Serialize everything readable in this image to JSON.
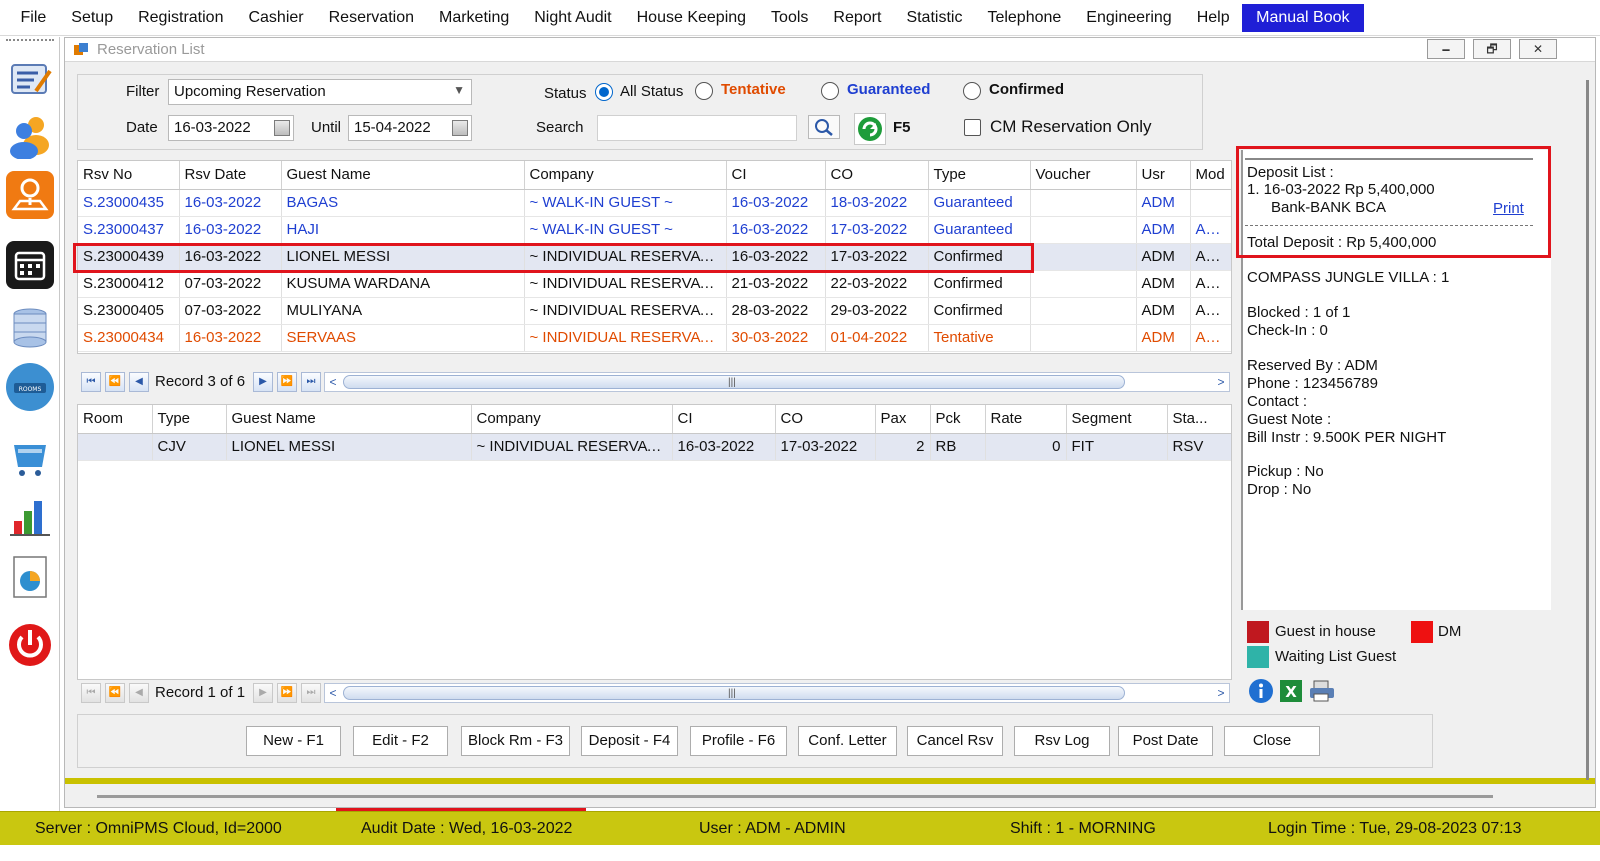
{
  "menu": [
    "File",
    "Setup",
    "Registration",
    "Cashier",
    "Reservation",
    "Marketing",
    "Night Audit",
    "House Keeping",
    "Tools",
    "Report",
    "Statistic",
    "Telephone",
    "Engineering",
    "Help",
    "Manual Book"
  ],
  "window": {
    "title": "Reservation List",
    "min": "🗕",
    "restore": "🗗",
    "close": "✕"
  },
  "filter": {
    "filter_label": "Filter",
    "filter_value": "Upcoming Reservation",
    "date_label": "Date",
    "date_from": "16-03-2022",
    "until_label": "Until",
    "date_until": "15-04-2022",
    "status_label": "Status",
    "status_all": "All Status",
    "status_tentative": "Tentative",
    "status_guaranteed": "Guaranteed",
    "status_confirmed": "Confirmed",
    "search_label": "Search",
    "search_value": "",
    "refresh_label": "F5",
    "cm_only": "CM Reservation Only",
    "tentative_color": "#e04b00",
    "guaranteed_color": "#1f3fd1",
    "confirmed_color": "#111111"
  },
  "reservations": {
    "headers": [
      "Rsv No",
      "Rsv Date",
      "Guest Name",
      "Company",
      "CI",
      "CO",
      "Type",
      "Voucher",
      "Usr",
      "Mod"
    ],
    "rows": [
      {
        "rsv_no": "S.23000435",
        "rsv_date": "16-03-2022",
        "guest": "BAGAS",
        "company": "~ WALK-IN GUEST ~",
        "ci": "16-03-2022",
        "co": "18-03-2022",
        "type": "Guaranteed",
        "voucher": "",
        "usr": "ADM",
        "mod": ""
      },
      {
        "rsv_no": "S.23000437",
        "rsv_date": "16-03-2022",
        "guest": "HAJI",
        "company": "~ WALK-IN GUEST ~",
        "ci": "16-03-2022",
        "co": "17-03-2022",
        "type": "Guaranteed",
        "voucher": "",
        "usr": "ADM",
        "mod": "ADM"
      },
      {
        "rsv_no": "S.23000439",
        "rsv_date": "16-03-2022",
        "guest": "LIONEL MESSI",
        "company": "~ INDIVIDUAL RESERVATI...",
        "ci": "16-03-2022",
        "co": "17-03-2022",
        "type": "Confirmed",
        "voucher": "",
        "usr": "ADM",
        "mod": "ADM"
      },
      {
        "rsv_no": "S.23000412",
        "rsv_date": "07-03-2022",
        "guest": "KUSUMA WARDANA",
        "company": "~ INDIVIDUAL RESERVATI...",
        "ci": "21-03-2022",
        "co": "22-03-2022",
        "type": "Confirmed",
        "voucher": "",
        "usr": "ADM",
        "mod": "ADM"
      },
      {
        "rsv_no": "S.23000405",
        "rsv_date": "07-03-2022",
        "guest": "MULIYANA",
        "company": "~ INDIVIDUAL RESERVATI...",
        "ci": "28-03-2022",
        "co": "29-03-2022",
        "type": "Confirmed",
        "voucher": "",
        "usr": "ADM",
        "mod": "ADM"
      },
      {
        "rsv_no": "S.23000434",
        "rsv_date": "16-03-2022",
        "guest": "SERVAAS",
        "company": "~ INDIVIDUAL RESERVATI...",
        "ci": "30-03-2022",
        "co": "01-04-2022",
        "type": "Tentative",
        "voucher": "",
        "usr": "ADM",
        "mod": "ADM"
      }
    ],
    "record_text": "Record 3 of 6"
  },
  "rooms": {
    "headers": [
      "Room",
      "Type",
      "Guest Name",
      "Company",
      "CI",
      "CO",
      "Pax",
      "Pck",
      "Rate",
      "Segment",
      "Sta..."
    ],
    "rows": [
      {
        "room": "",
        "type": "CJV",
        "guest": "LIONEL MESSI",
        "company": "~ INDIVIDUAL RESERVATI...",
        "ci": "16-03-2022",
        "co": "17-03-2022",
        "pax": "2",
        "pck": "RB",
        "rate": "0",
        "segment": "FIT",
        "status": "RSV"
      }
    ],
    "record_text": "Record 1 of 1"
  },
  "buttons": [
    "New - F1",
    "Edit - F2",
    "Block Rm - F3",
    "Deposit - F4",
    "Profile  - F6",
    "Conf. Letter",
    "Cancel Rsv",
    "Rsv Log",
    "Post Date",
    "Close"
  ],
  "info": {
    "deposit_list": "Deposit List :",
    "deposit_line1": "1. 16-03-2022   Rp 5,400,000",
    "deposit_line2": "Bank-BANK BCA",
    "print": "Print",
    "total_deposit": "Total Deposit : Rp 5,400,000",
    "room_type": "COMPASS JUNGLE VILLA : 1",
    "blocked": "Blocked : 1 of 1",
    "checkin": "Check-In : 0",
    "reserved_by": "Reserved By : ADM",
    "phone": "Phone : 123456789",
    "contact": "Contact :",
    "guest_note": "Guest Note :",
    "bill_instr": "Bill Instr : 9.500K PER NIGHT",
    "pickup": "Pickup : No",
    "drop": "Drop : No"
  },
  "legend": {
    "guest_in_house": "Guest in house",
    "dm": "DM",
    "waiting_list": "Waiting List Guest",
    "guest_in_house_color": "#c0181f",
    "dm_color": "#ee1111",
    "waiting_list_color": "#2fb3a8"
  },
  "status": {
    "server": "Server : OmniPMS Cloud, Id=2000",
    "audit": "Audit Date : Wed, 16-03-2022",
    "user": "User : ADM - ADMIN",
    "shift": "Shift : 1 - MORNING",
    "login": "Login Time : Tue, 29-08-2023 07:13"
  }
}
